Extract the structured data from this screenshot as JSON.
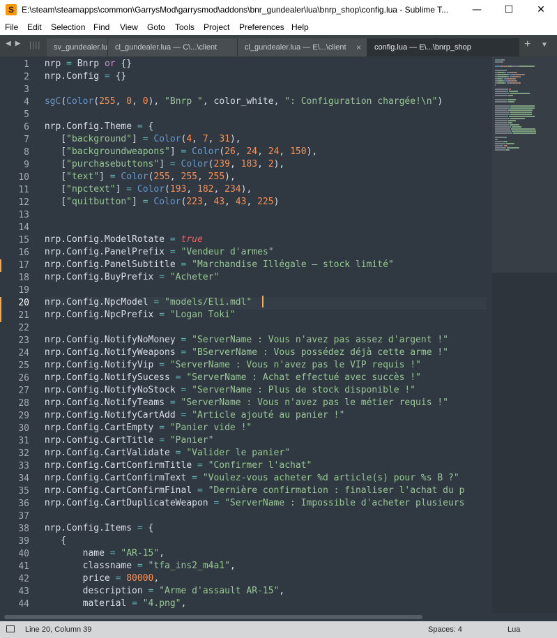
{
  "window": {
    "title": "E:\\steam\\steamapps\\common\\GarrysMod\\garrysmod\\addons\\bnr_gundealer\\lua\\bnrp_shop\\config.lua - Sublime T...",
    "app_icon": "S",
    "minimize_icon": "—",
    "maximize_icon": "☐",
    "close_icon": "✕"
  },
  "menu": [
    "File",
    "Edit",
    "Selection",
    "Find",
    "View",
    "Goto",
    "Tools",
    "Project",
    "Preferences",
    "Help"
  ],
  "tabs": [
    {
      "label": "sv_gundealer.lua",
      "active": false
    },
    {
      "label": "cl_gundealer.lua — C\\...\\client",
      "active": false
    },
    {
      "label": "cl_gundealer.lua — E\\...\\client",
      "active": false
    },
    {
      "label": "config.lua — E\\...\\bnrp_shop",
      "active": true
    }
  ],
  "tab_close_icon": "×",
  "tab_nav_icon": "◀▶",
  "tab_add_icon": "+",
  "tab_menu_icon": "▼",
  "editor": {
    "current_line": 20,
    "modified_lines": [
      17,
      20,
      21
    ],
    "lines": [
      [
        {
          "t": "Bnrp ",
          "c": "w"
        },
        {
          "t": "=",
          "c": "p"
        },
        {
          "t": " Bnrp ",
          "c": "w"
        },
        {
          "t": "or",
          "c": "k"
        },
        {
          "t": " {}",
          "c": "w"
        }
      ],
      [
        {
          "t": "Bnrp.Config ",
          "c": "w"
        },
        {
          "t": "=",
          "c": "p"
        },
        {
          "t": " {}",
          "c": "w"
        }
      ],
      [],
      [
        {
          "t": "MsgC",
          "c": "f"
        },
        {
          "t": "(",
          "c": "w"
        },
        {
          "t": "Color",
          "c": "f"
        },
        {
          "t": "(",
          "c": "w"
        },
        {
          "t": "255",
          "c": "n"
        },
        {
          "t": ", ",
          "c": "w"
        },
        {
          "t": "0",
          "c": "n"
        },
        {
          "t": ", ",
          "c": "w"
        },
        {
          "t": "0",
          "c": "n"
        },
        {
          "t": "), ",
          "c": "w"
        },
        {
          "t": "\"Bnrp \"",
          "c": "s"
        },
        {
          "t": ", color_white, ",
          "c": "w"
        },
        {
          "t": "\": Configuration chargée!\\n\"",
          "c": "s"
        },
        {
          "t": ")",
          "c": "w"
        }
      ],
      [],
      [
        {
          "t": "Bnrp.Config.Theme ",
          "c": "w"
        },
        {
          "t": "=",
          "c": "p"
        },
        {
          "t": " {",
          "c": "w"
        }
      ],
      [
        {
          "t": "    [",
          "c": "w"
        },
        {
          "t": "\"background\"",
          "c": "s"
        },
        {
          "t": "] ",
          "c": "w"
        },
        {
          "t": "=",
          "c": "p"
        },
        {
          "t": " ",
          "c": "w"
        },
        {
          "t": "Color",
          "c": "f"
        },
        {
          "t": "(",
          "c": "w"
        },
        {
          "t": "4",
          "c": "n"
        },
        {
          "t": ", ",
          "c": "w"
        },
        {
          "t": "7",
          "c": "n"
        },
        {
          "t": ", ",
          "c": "w"
        },
        {
          "t": "31",
          "c": "n"
        },
        {
          "t": "),",
          "c": "w"
        }
      ],
      [
        {
          "t": "    [",
          "c": "w"
        },
        {
          "t": "\"backgroundweapons\"",
          "c": "s"
        },
        {
          "t": "] ",
          "c": "w"
        },
        {
          "t": "=",
          "c": "p"
        },
        {
          "t": " ",
          "c": "w"
        },
        {
          "t": "Color",
          "c": "f"
        },
        {
          "t": "(",
          "c": "w"
        },
        {
          "t": "26",
          "c": "n"
        },
        {
          "t": ", ",
          "c": "w"
        },
        {
          "t": "24",
          "c": "n"
        },
        {
          "t": ", ",
          "c": "w"
        },
        {
          "t": "24",
          "c": "n"
        },
        {
          "t": ", ",
          "c": "w"
        },
        {
          "t": "150",
          "c": "n"
        },
        {
          "t": "),",
          "c": "w"
        }
      ],
      [
        {
          "t": "    [",
          "c": "w"
        },
        {
          "t": "\"purchasebuttons\"",
          "c": "s"
        },
        {
          "t": "] ",
          "c": "w"
        },
        {
          "t": "=",
          "c": "p"
        },
        {
          "t": " ",
          "c": "w"
        },
        {
          "t": "Color",
          "c": "f"
        },
        {
          "t": "(",
          "c": "w"
        },
        {
          "t": "239",
          "c": "n"
        },
        {
          "t": ", ",
          "c": "w"
        },
        {
          "t": "183",
          "c": "n"
        },
        {
          "t": ", ",
          "c": "w"
        },
        {
          "t": "2",
          "c": "n"
        },
        {
          "t": "),",
          "c": "w"
        }
      ],
      [
        {
          "t": "    [",
          "c": "w"
        },
        {
          "t": "\"text\"",
          "c": "s"
        },
        {
          "t": "] ",
          "c": "w"
        },
        {
          "t": "=",
          "c": "p"
        },
        {
          "t": " ",
          "c": "w"
        },
        {
          "t": "Color",
          "c": "f"
        },
        {
          "t": "(",
          "c": "w"
        },
        {
          "t": "255",
          "c": "n"
        },
        {
          "t": ", ",
          "c": "w"
        },
        {
          "t": "255",
          "c": "n"
        },
        {
          "t": ", ",
          "c": "w"
        },
        {
          "t": "255",
          "c": "n"
        },
        {
          "t": "),",
          "c": "w"
        }
      ],
      [
        {
          "t": "    [",
          "c": "w"
        },
        {
          "t": "\"npctext\"",
          "c": "s"
        },
        {
          "t": "] ",
          "c": "w"
        },
        {
          "t": "=",
          "c": "p"
        },
        {
          "t": " ",
          "c": "w"
        },
        {
          "t": "Color",
          "c": "f"
        },
        {
          "t": "(",
          "c": "w"
        },
        {
          "t": "193",
          "c": "n"
        },
        {
          "t": ", ",
          "c": "w"
        },
        {
          "t": "182",
          "c": "n"
        },
        {
          "t": ", ",
          "c": "w"
        },
        {
          "t": "234",
          "c": "n"
        },
        {
          "t": "),",
          "c": "w"
        }
      ],
      [
        {
          "t": "    [",
          "c": "w"
        },
        {
          "t": "\"quitbutton\"",
          "c": "s"
        },
        {
          "t": "] ",
          "c": "w"
        },
        {
          "t": "=",
          "c": "p"
        },
        {
          "t": " ",
          "c": "w"
        },
        {
          "t": "Color",
          "c": "f"
        },
        {
          "t": "(",
          "c": "w"
        },
        {
          "t": "223",
          "c": "n"
        },
        {
          "t": ", ",
          "c": "w"
        },
        {
          "t": "43",
          "c": "n"
        },
        {
          "t": ", ",
          "c": "w"
        },
        {
          "t": "43",
          "c": "n"
        },
        {
          "t": ", ",
          "c": "w"
        },
        {
          "t": "225",
          "c": "n"
        },
        {
          "t": ")",
          "c": "w"
        }
      ],
      [
        {
          "t": "}",
          "c": "w"
        }
      ],
      [],
      [
        {
          "t": "Bnrp.Config.ModelRotate ",
          "c": "w"
        },
        {
          "t": "=",
          "c": "p"
        },
        {
          "t": " ",
          "c": "w"
        },
        {
          "t": "true",
          "c": "i"
        }
      ],
      [
        {
          "t": "Bnrp.Config.PanelPrefix ",
          "c": "w"
        },
        {
          "t": "=",
          "c": "p"
        },
        {
          "t": " ",
          "c": "w"
        },
        {
          "t": "\"Vendeur d'armes\"",
          "c": "s"
        }
      ],
      [
        {
          "t": "Bnrp.Config.PanelSubtitle ",
          "c": "w"
        },
        {
          "t": "=",
          "c": "p"
        },
        {
          "t": " ",
          "c": "w"
        },
        {
          "t": "\"Marchandise Illégale — stock limité\"",
          "c": "s"
        }
      ],
      [
        {
          "t": "Bnrp.Config.BuyPrefix ",
          "c": "w"
        },
        {
          "t": "=",
          "c": "p"
        },
        {
          "t": " ",
          "c": "w"
        },
        {
          "t": "\"Acheter\"",
          "c": "s"
        }
      ],
      [],
      [
        {
          "t": "Bnrp.Config.NpcModel ",
          "c": "w"
        },
        {
          "t": "=",
          "c": "p"
        },
        {
          "t": " ",
          "c": "w"
        },
        {
          "t": "\"models/Eli.mdl\"",
          "c": "s"
        }
      ],
      [
        {
          "t": "Bnrp.Config.NpcPrefix ",
          "c": "w"
        },
        {
          "t": "=",
          "c": "p"
        },
        {
          "t": " ",
          "c": "w"
        },
        {
          "t": "\"Logan Toki\"",
          "c": "s"
        }
      ],
      [],
      [
        {
          "t": "Bnrp.Config.NotifyNoMoney ",
          "c": "w"
        },
        {
          "t": "=",
          "c": "p"
        },
        {
          "t": " ",
          "c": "w"
        },
        {
          "t": "\"ServerName : Vous n'avez pas assez d'argent !\"",
          "c": "s"
        }
      ],
      [
        {
          "t": "Bnrp.Config.NotifyWeapons ",
          "c": "w"
        },
        {
          "t": "=",
          "c": "p"
        },
        {
          "t": " ",
          "c": "w"
        },
        {
          "t": "\"BServerName : Vous possédez déjà cette arme !\"",
          "c": "s"
        }
      ],
      [
        {
          "t": "Bnrp.Config.NotifyVip ",
          "c": "w"
        },
        {
          "t": "=",
          "c": "p"
        },
        {
          "t": " ",
          "c": "w"
        },
        {
          "t": "\"ServerName : Vous n'avez pas le VIP requis !\"",
          "c": "s"
        }
      ],
      [
        {
          "t": "Bnrp.Config.NotifySucess ",
          "c": "w"
        },
        {
          "t": "=",
          "c": "p"
        },
        {
          "t": " ",
          "c": "w"
        },
        {
          "t": "\"ServerName : Achat effectué avec succès !\"",
          "c": "s"
        }
      ],
      [
        {
          "t": "Bnrp.Config.NotifyNoStock ",
          "c": "w"
        },
        {
          "t": "=",
          "c": "p"
        },
        {
          "t": " ",
          "c": "w"
        },
        {
          "t": "\"ServerName : Plus de stock disponible !\"",
          "c": "s"
        }
      ],
      [
        {
          "t": "Bnrp.Config.NotifyTeams ",
          "c": "w"
        },
        {
          "t": "=",
          "c": "p"
        },
        {
          "t": " ",
          "c": "w"
        },
        {
          "t": "\"ServerName : Vous n'avez pas le métier requis !\"",
          "c": "s"
        }
      ],
      [
        {
          "t": "Bnrp.Config.NotifyCartAdd ",
          "c": "w"
        },
        {
          "t": "=",
          "c": "p"
        },
        {
          "t": " ",
          "c": "w"
        },
        {
          "t": "\"Article ajouté au panier !\"",
          "c": "s"
        }
      ],
      [
        {
          "t": "Bnrp.Config.CartEmpty ",
          "c": "w"
        },
        {
          "t": "=",
          "c": "p"
        },
        {
          "t": " ",
          "c": "w"
        },
        {
          "t": "\"Panier vide !\"",
          "c": "s"
        }
      ],
      [
        {
          "t": "Bnrp.Config.CartTitle ",
          "c": "w"
        },
        {
          "t": "=",
          "c": "p"
        },
        {
          "t": " ",
          "c": "w"
        },
        {
          "t": "\"Panier\"",
          "c": "s"
        }
      ],
      [
        {
          "t": "Bnrp.Config.CartValidate ",
          "c": "w"
        },
        {
          "t": "=",
          "c": "p"
        },
        {
          "t": " ",
          "c": "w"
        },
        {
          "t": "\"Valider le panier\"",
          "c": "s"
        }
      ],
      [
        {
          "t": "Bnrp.Config.CartConfirmTitle ",
          "c": "w"
        },
        {
          "t": "=",
          "c": "p"
        },
        {
          "t": " ",
          "c": "w"
        },
        {
          "t": "\"Confirmer l'achat\"",
          "c": "s"
        }
      ],
      [
        {
          "t": "Bnrp.Config.CartConfirmText ",
          "c": "w"
        },
        {
          "t": "=",
          "c": "p"
        },
        {
          "t": " ",
          "c": "w"
        },
        {
          "t": "\"Voulez-vous acheter %d article(s) pour %s B ?\"",
          "c": "s"
        }
      ],
      [
        {
          "t": "Bnrp.Config.CartConfirmFinal ",
          "c": "w"
        },
        {
          "t": "=",
          "c": "p"
        },
        {
          "t": " ",
          "c": "w"
        },
        {
          "t": "\"Dernière confirmation : finaliser l'achat du p",
          "c": "s"
        }
      ],
      [
        {
          "t": "Bnrp.Config.CartDuplicateWeapon ",
          "c": "w"
        },
        {
          "t": "=",
          "c": "p"
        },
        {
          "t": " ",
          "c": "w"
        },
        {
          "t": "\"ServerName : Impossible d'acheter plusieurs",
          "c": "s"
        }
      ],
      [],
      [
        {
          "t": "Bnrp.Config.Items ",
          "c": "w"
        },
        {
          "t": "=",
          "c": "p"
        },
        {
          "t": " {",
          "c": "w"
        }
      ],
      [
        {
          "t": "    {",
          "c": "w"
        }
      ],
      [
        {
          "t": "        name ",
          "c": "w"
        },
        {
          "t": "=",
          "c": "p"
        },
        {
          "t": " ",
          "c": "w"
        },
        {
          "t": "\"AR-15\"",
          "c": "s"
        },
        {
          "t": ",",
          "c": "w"
        }
      ],
      [
        {
          "t": "        classname ",
          "c": "w"
        },
        {
          "t": "=",
          "c": "p"
        },
        {
          "t": " ",
          "c": "w"
        },
        {
          "t": "\"tfa_ins2_m4a1\"",
          "c": "s"
        },
        {
          "t": ",",
          "c": "w"
        }
      ],
      [
        {
          "t": "        price ",
          "c": "w"
        },
        {
          "t": "=",
          "c": "p"
        },
        {
          "t": " ",
          "c": "w"
        },
        {
          "t": "80000",
          "c": "n"
        },
        {
          "t": ",",
          "c": "w"
        }
      ],
      [
        {
          "t": "        description ",
          "c": "w"
        },
        {
          "t": "=",
          "c": "p"
        },
        {
          "t": " ",
          "c": "w"
        },
        {
          "t": "\"Arme d'assault AR-15\"",
          "c": "s"
        },
        {
          "t": ",",
          "c": "w"
        }
      ],
      [
        {
          "t": "        material ",
          "c": "w"
        },
        {
          "t": "=",
          "c": "p"
        },
        {
          "t": " ",
          "c": "w"
        },
        {
          "t": "\"4.png\"",
          "c": "s"
        },
        {
          "t": ",",
          "c": "w"
        }
      ]
    ]
  },
  "status": {
    "position": "Line 20, Column 39",
    "indent": "Spaces: 4",
    "syntax": "Lua"
  },
  "colors": {
    "editor_bg": "#303841",
    "keyword": "#c594c5",
    "string": "#99c794",
    "number": "#f99157",
    "function": "#6699cc",
    "operator": "#5fb3b3",
    "boolean": "#ec5f66",
    "modified_marker": "#f4a64d"
  }
}
